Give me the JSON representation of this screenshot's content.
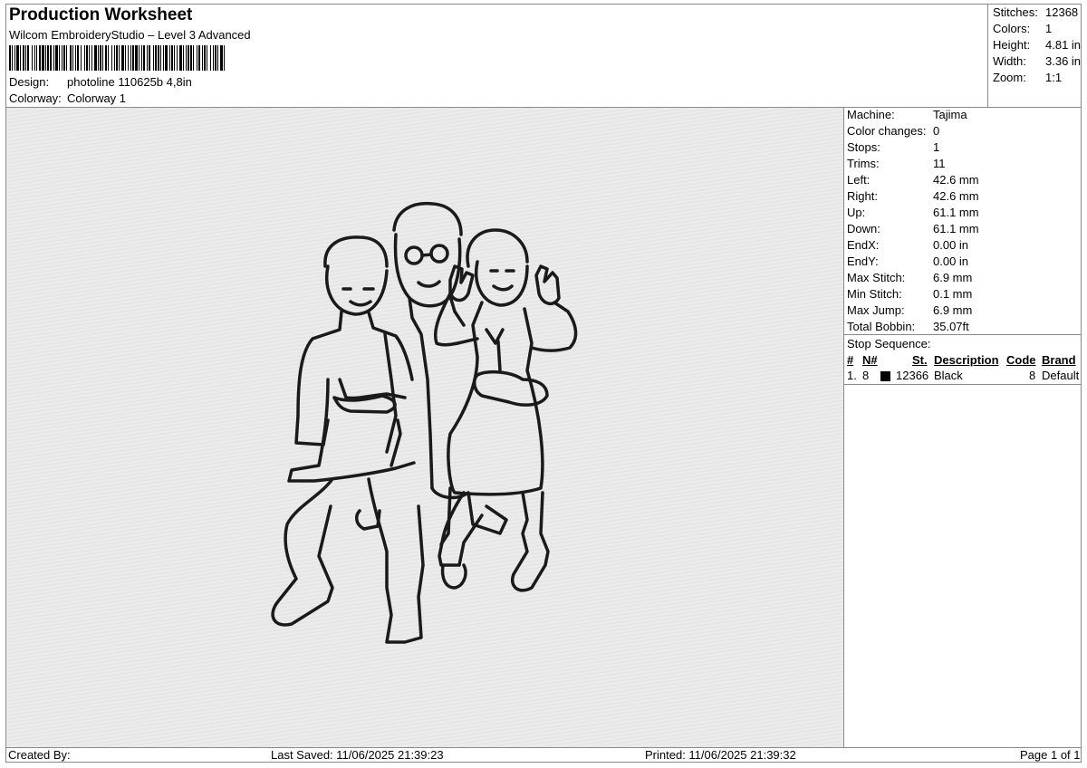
{
  "header": {
    "title": "Production Worksheet",
    "software": "Wilcom EmbroideryStudio – Level 3 Advanced",
    "design_label": "Design:",
    "design_value": "photoline 110625b 4,8in",
    "colorway_label": "Colorway:",
    "colorway_value": "Colorway 1"
  },
  "summary": [
    {
      "label": "Stitches:",
      "value": "12368"
    },
    {
      "label": "Colors:",
      "value": "1"
    },
    {
      "label": "Height:",
      "value": "4.81 in"
    },
    {
      "label": "Width:",
      "value": "3.36 in"
    },
    {
      "label": "Zoom:",
      "value": "1:1"
    }
  ],
  "machine_stats": [
    {
      "label": "Machine:",
      "value": "Tajima"
    },
    {
      "label": "Color changes:",
      "value": "0"
    },
    {
      "label": "Stops:",
      "value": "1"
    },
    {
      "label": "Trims:",
      "value": "11"
    },
    {
      "label": "Left:",
      "value": "42.6 mm"
    },
    {
      "label": "Right:",
      "value": "42.6 mm"
    },
    {
      "label": "Up:",
      "value": "61.1 mm"
    },
    {
      "label": "Down:",
      "value": "61.1 mm"
    },
    {
      "label": "EndX:",
      "value": "0.00 in"
    },
    {
      "label": "EndY:",
      "value": "0.00 in"
    },
    {
      "label": "Max Stitch:",
      "value": "6.9 mm"
    },
    {
      "label": "Min Stitch:",
      "value": "0.1 mm"
    },
    {
      "label": "Max Jump:",
      "value": "6.9 mm"
    },
    {
      "label": "Total Bobbin:",
      "value": "35.07ft"
    }
  ],
  "stop_sequence": {
    "title": "Stop Sequence:",
    "columns": [
      "#",
      "N#",
      "St.",
      "Description",
      "Code",
      "Brand"
    ],
    "rows": [
      {
        "index": "1.",
        "n": "8",
        "swatch_color": "#000000",
        "stitches": "12366",
        "description": "Black",
        "code": "8",
        "brand": "Default"
      }
    ]
  },
  "footer": {
    "created_by": "Created By:",
    "last_saved": "Last Saved: 11/06/2025 21:39:23",
    "printed": "Printed: 11/06/2025 21:39:32",
    "page": "Page 1 of 1"
  },
  "design_preview": {
    "thread_color": "#1a1a1a"
  }
}
